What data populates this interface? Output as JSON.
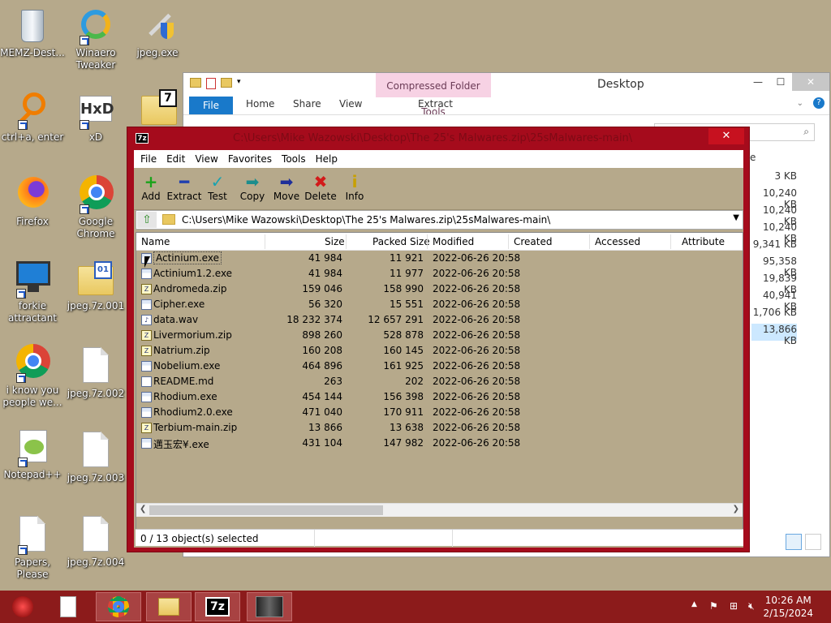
{
  "desktop": {
    "icons": [
      {
        "label": "MEMZ-Dest..."
      },
      {
        "label": "Winaero Tweaker"
      },
      {
        "label": "jpeg.exe"
      },
      {
        "label": "ctrl+a, enter"
      },
      {
        "label": "xD"
      },
      {
        "label": "Firefox"
      },
      {
        "label": "Google Chrome"
      },
      {
        "label": "forkie attractant"
      },
      {
        "label": "jpeg.7z.001"
      },
      {
        "label": "i know you people we..."
      },
      {
        "label": "jpeg.7z.002"
      },
      {
        "label": "Notepad++"
      },
      {
        "label": "jpeg.7z.003"
      },
      {
        "label": "Papers, Please"
      },
      {
        "label": "jpeg.7z.004"
      }
    ]
  },
  "explorer": {
    "title": "Desktop",
    "contextual_tab": "Compressed Folder Tools",
    "tabs": {
      "file": "File",
      "home": "Home",
      "share": "Share",
      "view": "View",
      "extract": "Extract"
    },
    "column_fragment": "e",
    "sizes": [
      "3 KB",
      "10,240 KB",
      "10,240 KB",
      "10,240 KB",
      "9,341 KB",
      "95,358 KB",
      "19,839 KB",
      "40,941 KB",
      "1,706 KB",
      "13,866 KB"
    ]
  },
  "zip": {
    "title": "C:\\Users\\Mike Wazowski\\Desktop\\The 25's Malwares.zip\\25sMalwares-main\\",
    "menu": [
      "File",
      "Edit",
      "View",
      "Favorites",
      "Tools",
      "Help"
    ],
    "toolbar": {
      "add": "Add",
      "extract": "Extract",
      "test": "Test",
      "copy": "Copy",
      "move": "Move",
      "delete": "Delete",
      "info": "Info"
    },
    "address": "C:\\Users\\Mike Wazowski\\Desktop\\The 25's Malwares.zip\\25sMalwares-main\\",
    "columns": {
      "name": "Name",
      "size": "Size",
      "packed": "Packed Size",
      "modified": "Modified",
      "created": "Created",
      "accessed": "Accessed",
      "attributes": "Attribute"
    },
    "files": [
      {
        "name": "Actinium.exe",
        "size": "41 984",
        "packed": "11 921",
        "modified": "2022-06-26 20:58",
        "type": "exe"
      },
      {
        "name": "Actinium1.2.exe",
        "size": "41 984",
        "packed": "11 977",
        "modified": "2022-06-26 20:58",
        "type": "exe"
      },
      {
        "name": "Andromeda.zip",
        "size": "159 046",
        "packed": "158 990",
        "modified": "2022-06-26 20:58",
        "type": "zip"
      },
      {
        "name": "Cipher.exe",
        "size": "56 320",
        "packed": "15 551",
        "modified": "2022-06-26 20:58",
        "type": "exe"
      },
      {
        "name": "data.wav",
        "size": "18 232 374",
        "packed": "12 657 291",
        "modified": "2022-06-26 20:58",
        "type": "wav"
      },
      {
        "name": "Livermorium.zip",
        "size": "898 260",
        "packed": "528 878",
        "modified": "2022-06-26 20:58",
        "type": "zip"
      },
      {
        "name": "Natrium.zip",
        "size": "160 208",
        "packed": "160 145",
        "modified": "2022-06-26 20:58",
        "type": "zip"
      },
      {
        "name": "Nobelium.exe",
        "size": "464 896",
        "packed": "161 925",
        "modified": "2022-06-26 20:58",
        "type": "exe"
      },
      {
        "name": "README.md",
        "size": "263",
        "packed": "202",
        "modified": "2022-06-26 20:58",
        "type": "txt"
      },
      {
        "name": "Rhodium.exe",
        "size": "454 144",
        "packed": "156 398",
        "modified": "2022-06-26 20:58",
        "type": "exe"
      },
      {
        "name": "Rhodium2.0.exe",
        "size": "471 040",
        "packed": "170 911",
        "modified": "2022-06-26 20:58",
        "type": "exe"
      },
      {
        "name": "Terbium-main.zip",
        "size": "13 866",
        "packed": "13 638",
        "modified": "2022-06-26 20:58",
        "type": "zip"
      },
      {
        "name": "邁玉宏¥.exe",
        "size": "431 104",
        "packed": "147 982",
        "modified": "2022-06-26 20:58",
        "type": "exe"
      }
    ],
    "status": "0 / 13 object(s) selected"
  },
  "taskbar": {
    "time": "10:26 AM",
    "date": "2/15/2024",
    "seven_zip_label": "7z"
  },
  "colors": {
    "zip_frame": "#a50b1c",
    "taskbar": "#8c1b1b",
    "desktop": "#b6a98b"
  }
}
